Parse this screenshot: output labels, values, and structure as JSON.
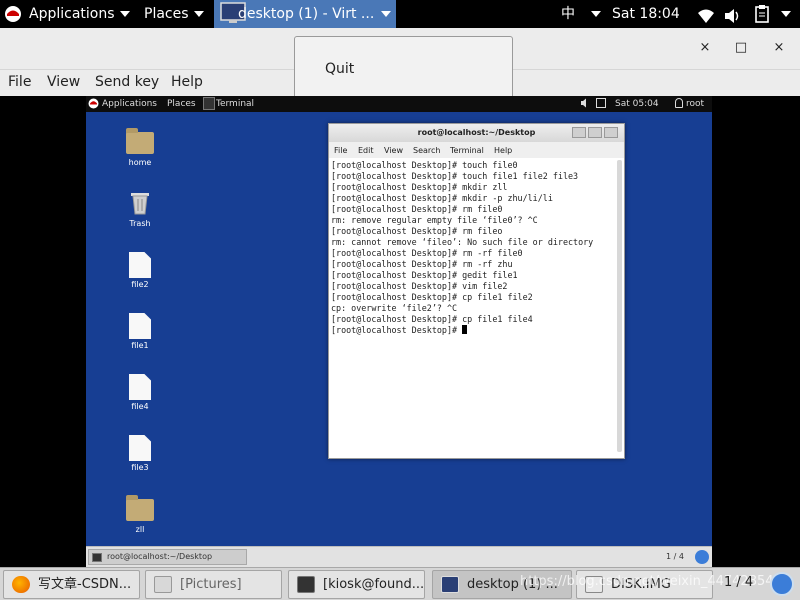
{
  "host_top_panel": {
    "applications": "Applications",
    "places": "Places",
    "active_task": "desktop (1) - Virt ...",
    "input_method": "中",
    "clock": "Sat 18:04"
  },
  "quit_popup": {
    "label": "Quit"
  },
  "vm_menu": {
    "file": "File",
    "view": "View",
    "send_key": "Send key",
    "help": "Help"
  },
  "vm_window_buttons": {
    "minimize": "×",
    "maximize": "□",
    "close": "×"
  },
  "guest": {
    "top_panel": {
      "applications": "Applications",
      "places": "Places",
      "terminal": "Terminal",
      "clock": "Sat 05:04",
      "user": "root"
    },
    "desktop_icons": [
      {
        "label": "home"
      },
      {
        "label": "Trash"
      },
      {
        "label": "file2"
      },
      {
        "label": "file1"
      },
      {
        "label": "file4"
      },
      {
        "label": "file3"
      },
      {
        "label": "zll"
      }
    ],
    "terminal": {
      "title": "root@localhost:~/Desktop",
      "menu": [
        "File",
        "Edit",
        "View",
        "Search",
        "Terminal",
        "Help"
      ],
      "lines": [
        "[root@localhost Desktop]# touch file0",
        "[root@localhost Desktop]# touch file1 file2 file3",
        "[root@localhost Desktop]# mkdir zll",
        "[root@localhost Desktop]# mkdir -p zhu/li/li",
        "[root@localhost Desktop]# rm file0",
        "rm: remove regular empty file ‘file0’? ^C",
        "[root@localhost Desktop]# rm fileo",
        "rm: cannot remove ‘fileo’: No such file or directory",
        "[root@localhost Desktop]# rm -rf file0",
        "[root@localhost Desktop]# rm -rf zhu",
        "[root@localhost Desktop]# gedit file1",
        "[root@localhost Desktop]# vim file2",
        "[root@localhost Desktop]# cp file1 file2",
        "cp: overwrite ‘file2’? ^C",
        "[root@localhost Desktop]# cp file1 file4"
      ],
      "prompt": "[root@localhost Desktop]# "
    },
    "bottom_panel": {
      "task": "root@localhost:~/Desktop",
      "workspace": "1 / 4"
    }
  },
  "host_taskbar": {
    "tasks": [
      {
        "label": "写文章-CSDN..."
      },
      {
        "label": "[Pictures]"
      },
      {
        "label": "[kiosk@found..."
      },
      {
        "label": "desktop (1) ..."
      },
      {
        "label": "DISK.IMG"
      }
    ],
    "watermark": "https://blog.csdn.net/weixin_44742854",
    "workspace": "1 / 4"
  }
}
